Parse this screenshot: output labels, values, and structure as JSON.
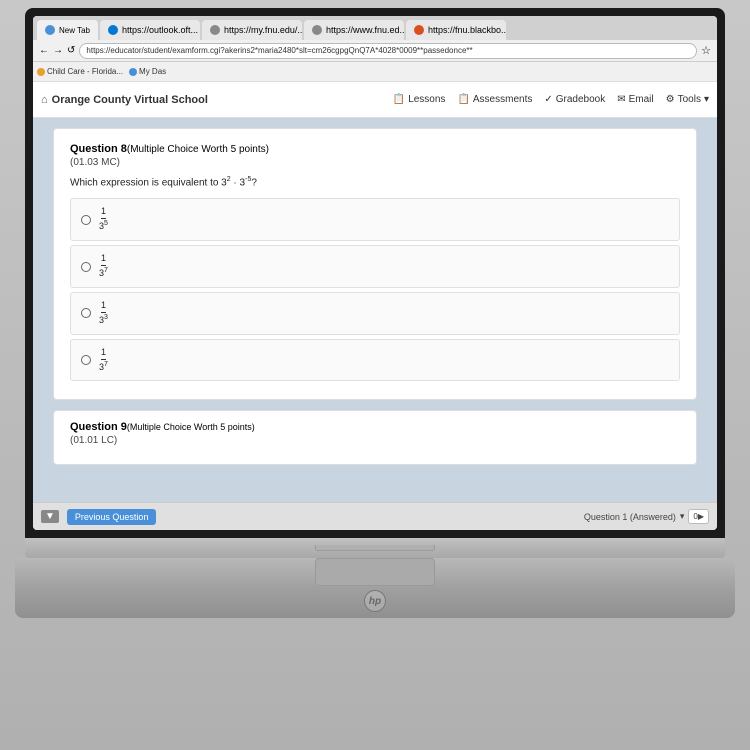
{
  "browser": {
    "tabs": [
      {
        "label": "New Tab",
        "icon": "circle",
        "active": false
      },
      {
        "label": "https://outlook.ofh...",
        "icon": "mail",
        "active": false
      },
      {
        "label": "https://my.fnu.edu/...",
        "icon": "globe",
        "active": false
      },
      {
        "label": "https://www.fnu.ed...",
        "icon": "globe",
        "active": false
      },
      {
        "label": "https://fnu.blackbo...",
        "icon": "square",
        "active": true
      }
    ],
    "url": "https://educator/student/examform.cgi?akerins2*maria2480*slt=cm26cgpgQnQ7A*4028*0009**passedonce**",
    "bookmarks": [
      {
        "label": "Child Care - Florida..."
      },
      {
        "label": "My Das"
      }
    ]
  },
  "lms": {
    "site_title": "Orange County Virtual School",
    "nav_items": [
      {
        "label": "Lessons",
        "icon": "📋"
      },
      {
        "label": "Assessments",
        "icon": "📋"
      },
      {
        "label": "Gradebook",
        "icon": "✓"
      },
      {
        "label": "Email",
        "icon": "✉"
      },
      {
        "label": "Tools",
        "icon": "⚙"
      }
    ]
  },
  "questions": [
    {
      "number": "8",
      "type": "Multiple Choice Worth 5 points",
      "standard": "(01.03 MC)",
      "text": "Which expression is equivalent to 3² · 3⁻⁵?",
      "options": [
        {
          "fraction_num": "1",
          "fraction_den": "3⁵"
        },
        {
          "fraction_num": "1",
          "fraction_den": "3⁷"
        },
        {
          "fraction_num": "1",
          "fraction_den": "3³"
        },
        {
          "fraction_num": "1",
          "fraction_den": "3⁷"
        }
      ]
    },
    {
      "number": "9",
      "type": "Multiple Choice Worth 5 points",
      "standard": "(01.01 LC)"
    }
  ],
  "footer": {
    "prev_button": "Previous Question",
    "status": "Question 1 (Answered)"
  },
  "icons": {
    "home": "⌂",
    "hp_logo": "hp"
  }
}
